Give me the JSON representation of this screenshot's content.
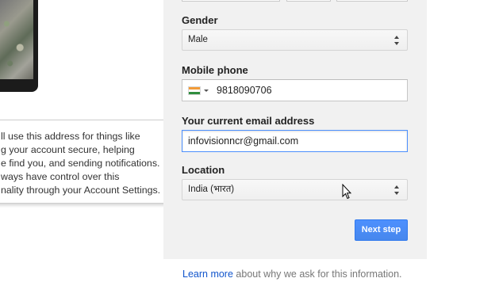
{
  "tooltip": {
    "lines": [
      "ll use this address for things like",
      "g your account secure, helping",
      "e find you, and sending notifications.",
      "ways have control over this",
      "nality through your Account Settings."
    ]
  },
  "form": {
    "gender": {
      "label": "Gender",
      "value": "Male"
    },
    "mobile": {
      "label": "Mobile phone",
      "value": "9818090706",
      "country_flag": "india-flag-icon"
    },
    "email": {
      "label": "Your current email address",
      "value": "infovisionncr@gmail.com"
    },
    "location": {
      "label": "Location",
      "value": "India (भारत)"
    },
    "next_button": "Next step"
  },
  "footer": {
    "link": "Learn more",
    "text": " about why we ask for this information."
  },
  "colors": {
    "panel_bg": "#f1f1f1",
    "button_blue": "#4d90fe",
    "link_blue": "#1155cc",
    "focus_border": "#4d90fe"
  }
}
